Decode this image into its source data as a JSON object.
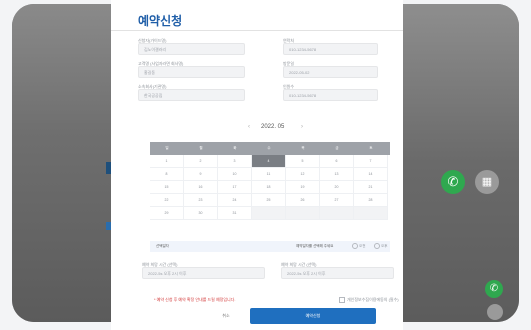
{
  "modal": {
    "title": "예약신청",
    "left_labels": [
      "신청자(가이드명)",
      "고객명 (사업자라면 회사명)",
      "소속회사(기관명)"
    ],
    "left_values": [
      "김노이갤러리",
      "홍길동",
      "한국공공집"
    ],
    "right_labels": [
      "연락처",
      "방문일",
      "인원수"
    ],
    "right_values": [
      "010-1234-5678",
      "2022-05-02",
      "010-1234-5678"
    ],
    "month_label": "2022. 05",
    "weekday_labels": [
      "일",
      "월",
      "화",
      "수",
      "목",
      "금",
      "토"
    ],
    "days": [
      "1",
      "2",
      "3",
      "4",
      "5",
      "6",
      "7",
      "8",
      "9",
      "10",
      "11",
      "12",
      "13",
      "14",
      "15",
      "16",
      "17",
      "18",
      "19",
      "20",
      "21",
      "22",
      "23",
      "24",
      "25",
      "26",
      "27",
      "28",
      "29",
      "30",
      "31"
    ],
    "selected_day": "4",
    "footer_left": "선택일자",
    "footer_mid": "예약일자를 선택해 주세요",
    "footer_opt1": "오전",
    "footer_opt2": "오후",
    "time1_label": "예약 희망 시간 (선택)",
    "time2_label": "예약 희망 시간 (선택)",
    "time1_value": "2022-5s 오후 2시 이후",
    "time2_value": "2022-5s 오후 2시 이후",
    "warn_text": "* 예약 신청 후 예약 확정 안내를 드릴 예정입니다.",
    "agree_text": "개인정보수집이용에동의 (필수)",
    "cancel_label": "취소",
    "submit_label": "예약신청"
  },
  "background": {
    "call_icon": "phone-icon",
    "gray_icon": "calendar-icon"
  },
  "colors": {
    "accent": "#1f6fbf",
    "title_blue": "#1f5ea8",
    "call_green": "#2fa84f",
    "warn_red": "#d33b3b"
  }
}
